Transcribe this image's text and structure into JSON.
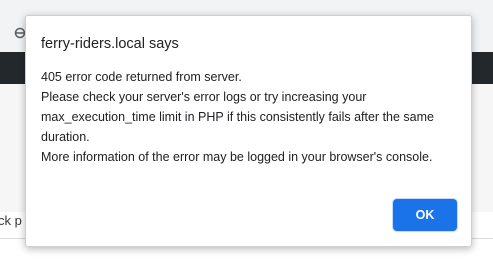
{
  "background": {
    "nav_icon": "reload-icon",
    "partial_text": "ck p"
  },
  "dialog": {
    "title": "ferry-riders.local says",
    "message_lines": [
      "405 error code returned from server.",
      "Please check your server's error logs or try increasing your",
      "max_execution_time limit in PHP if this consistently fails after the same",
      "duration.",
      "More information of the error may be logged in your browser's console."
    ],
    "ok_label": "OK"
  },
  "colors": {
    "accent": "#1a73e8",
    "admin_bar": "#23282d",
    "toolbar": "#f1f3f4",
    "text": "#202124"
  }
}
